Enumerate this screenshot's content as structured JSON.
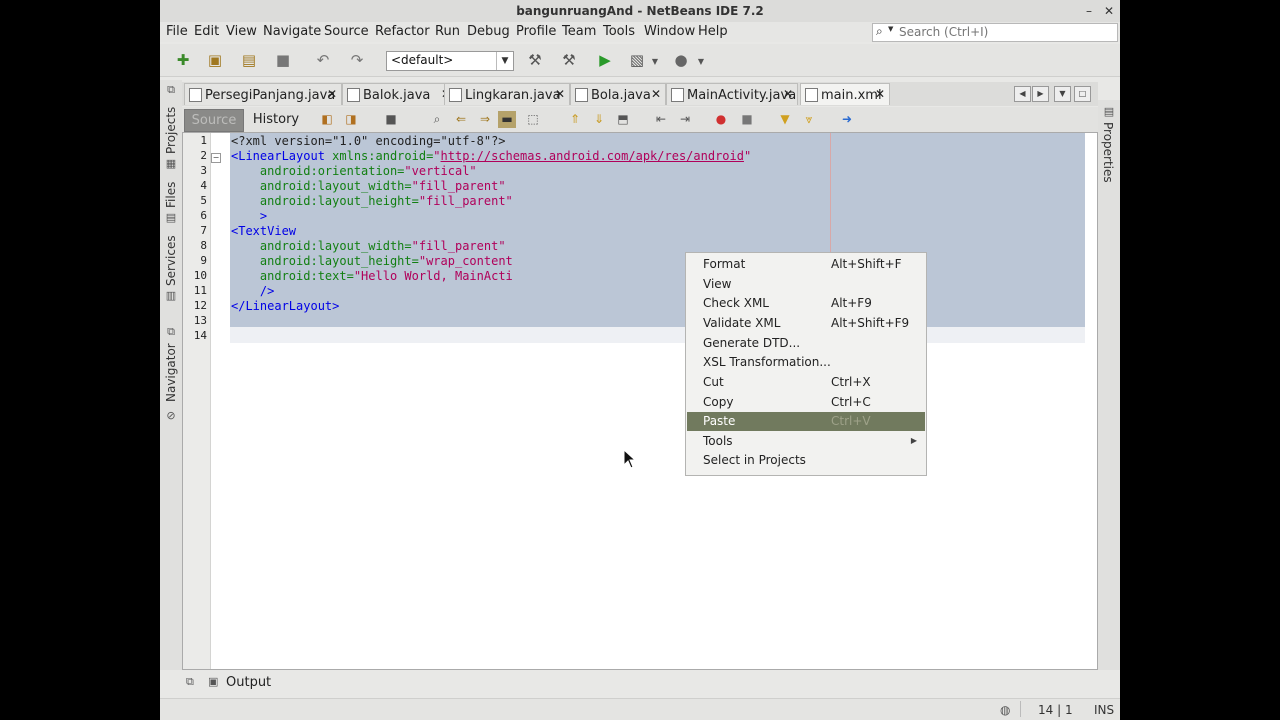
{
  "window": {
    "title": "bangunruangAnd - NetBeans IDE 7.2"
  },
  "menu": [
    "File",
    "Edit",
    "View",
    "Navigate",
    "Source",
    "Refactor",
    "Run",
    "Debug",
    "Profile",
    "Team",
    "Tools",
    "Window",
    "Help"
  ],
  "search": {
    "placeholder": "Search (Ctrl+I)"
  },
  "toolbar": {
    "config": "<default>"
  },
  "left_panels": {
    "projects": "Projects",
    "files": "Files",
    "services": "Services",
    "navigator": "Navigator"
  },
  "right_panels": {
    "properties": "Properties"
  },
  "tabs": [
    {
      "label": "PersegiPanjang.java",
      "active": false
    },
    {
      "label": "Balok.java",
      "active": false
    },
    {
      "label": "Lingkaran.java",
      "active": false
    },
    {
      "label": "Bola.java",
      "active": false
    },
    {
      "label": "MainActivity.java",
      "active": false
    },
    {
      "label": "main.xml",
      "active": true
    }
  ],
  "editor_toolbar": {
    "source": "Source",
    "history": "History"
  },
  "code": {
    "line_numbers": [
      "1",
      "2",
      "3",
      "4",
      "5",
      "6",
      "7",
      "8",
      "9",
      "10",
      "11",
      "12",
      "13",
      "14"
    ],
    "l1": {
      "open": "<?xml version=\"1.0\" encoding=\"utf-8\"?>"
    },
    "l2": {
      "tag": "<LinearLayout",
      "attr": " xmlns:android=",
      "q": "\"",
      "url": "http://schemas.android.com/apk/res/android",
      "q2": "\""
    },
    "l3": {
      "attr": "    android:orientation=",
      "val": "\"vertical\""
    },
    "l4": {
      "attr": "    android:layout_width=",
      "val": "\"fill_parent\""
    },
    "l5": {
      "attr": "    android:layout_height=",
      "val": "\"fill_parent\""
    },
    "l6": {
      "tag": "    >"
    },
    "l7": {
      "tag": "<TextView"
    },
    "l8": {
      "attr": "    android:layout_width=",
      "val": "\"fill_parent\""
    },
    "l9": {
      "attr": "    android:layout_height=",
      "val": "\"wrap_content"
    },
    "l10": {
      "attr": "    android:text=",
      "val": "\"Hello World, MainActi"
    },
    "l11": {
      "tag": "    />"
    },
    "l12": {
      "tag": "</LinearLayout>"
    }
  },
  "context_menu": [
    {
      "label": "Format",
      "shortcut": "Alt+Shift+F"
    },
    {
      "label": "View",
      "shortcut": ""
    },
    {
      "label": "Check XML",
      "shortcut": "Alt+F9"
    },
    {
      "label": "Validate XML",
      "shortcut": "Alt+Shift+F9"
    },
    {
      "label": "Generate DTD...",
      "shortcut": ""
    },
    {
      "label": "XSL Transformation...",
      "shortcut": ""
    },
    {
      "label": "Cut",
      "shortcut": "Ctrl+X"
    },
    {
      "label": "Copy",
      "shortcut": "Ctrl+C"
    },
    {
      "label": "Paste",
      "shortcut": "Ctrl+V",
      "highlighted": true
    },
    {
      "label": "Tools",
      "shortcut": "",
      "submenu": true
    },
    {
      "label": "Select in Projects",
      "shortcut": ""
    }
  ],
  "output": {
    "label": "Output"
  },
  "status": {
    "position": "14 | 1",
    "mode": "INS"
  },
  "colors": {
    "selection": "#bbc6d6",
    "menu_highlight": "#717a5e",
    "tag": "#0000e6",
    "attr": "#127f12",
    "value": "#b0005a"
  }
}
